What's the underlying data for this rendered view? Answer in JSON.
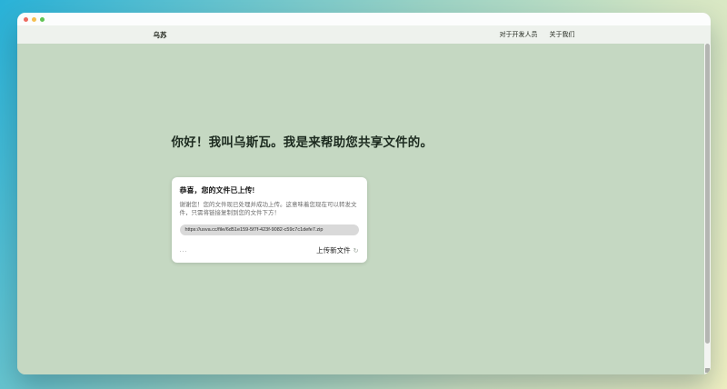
{
  "navbar": {
    "brand": "乌苏",
    "links": [
      "对于开发人员",
      "关于我们"
    ]
  },
  "hero": {
    "heading": "你好！我叫乌斯瓦。我是来帮助您共享文件的。"
  },
  "upload_card": {
    "title": "恭喜，您的文件已上传!",
    "description": "谢谢您！您的文件现已处理并成功上传。这意味着您现在可以转发文件，只需将链接复制到您的文件下方！",
    "file_url": "https://usva.cc/file/6d51e159-5f7f-423f-9082-c59c7c1defe7.zip",
    "more_label": "...",
    "upload_new_label": "上传新文件",
    "upload_new_icon": "↻"
  },
  "colors": {
    "gradient_start": "#29b2d8",
    "gradient_end": "#f1f1c3",
    "page_background": "#c5d8c2",
    "navbar_background": "#eef2ed",
    "card_background": "#ffffff",
    "url_pill_background": "#d9d9d9",
    "traffic_red": "#ee6a5f",
    "traffic_yellow": "#f5bf4f",
    "traffic_green": "#61c454"
  }
}
